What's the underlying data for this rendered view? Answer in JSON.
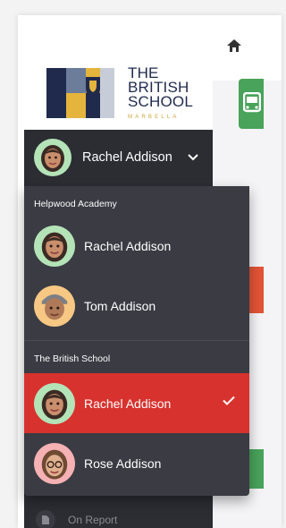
{
  "logo": {
    "line1": "THE",
    "line2": "BRITISH",
    "line3": "SCHOOL",
    "sub": "MARBELLA"
  },
  "current_user": {
    "name": "Rachel Addison"
  },
  "dropdown": {
    "groups": [
      {
        "label": "Helpwood Academy",
        "items": [
          {
            "name": "Rachel Addison",
            "avatar": "memoji-woman-dark-hair",
            "color": "#b4e3b8"
          },
          {
            "name": "Tom Addison",
            "avatar": "memoji-man-cap",
            "color": "#f7c784"
          }
        ]
      },
      {
        "label": "The British School",
        "items": [
          {
            "name": "Rachel Addison",
            "avatar": "memoji-woman-dark-hair",
            "color": "#b4e3b8",
            "selected": true
          },
          {
            "name": "Rose Addison",
            "avatar": "memoji-woman-glasses",
            "color": "#f6b1b4"
          }
        ]
      }
    ]
  },
  "nav": {
    "on_report": "On Report"
  },
  "colors": {
    "sidebar": "#2b2d33",
    "dropdown": "#3a3b43",
    "selected": "#d8322e",
    "accent_green": "#49a35a",
    "accent_red": "#e35436"
  }
}
